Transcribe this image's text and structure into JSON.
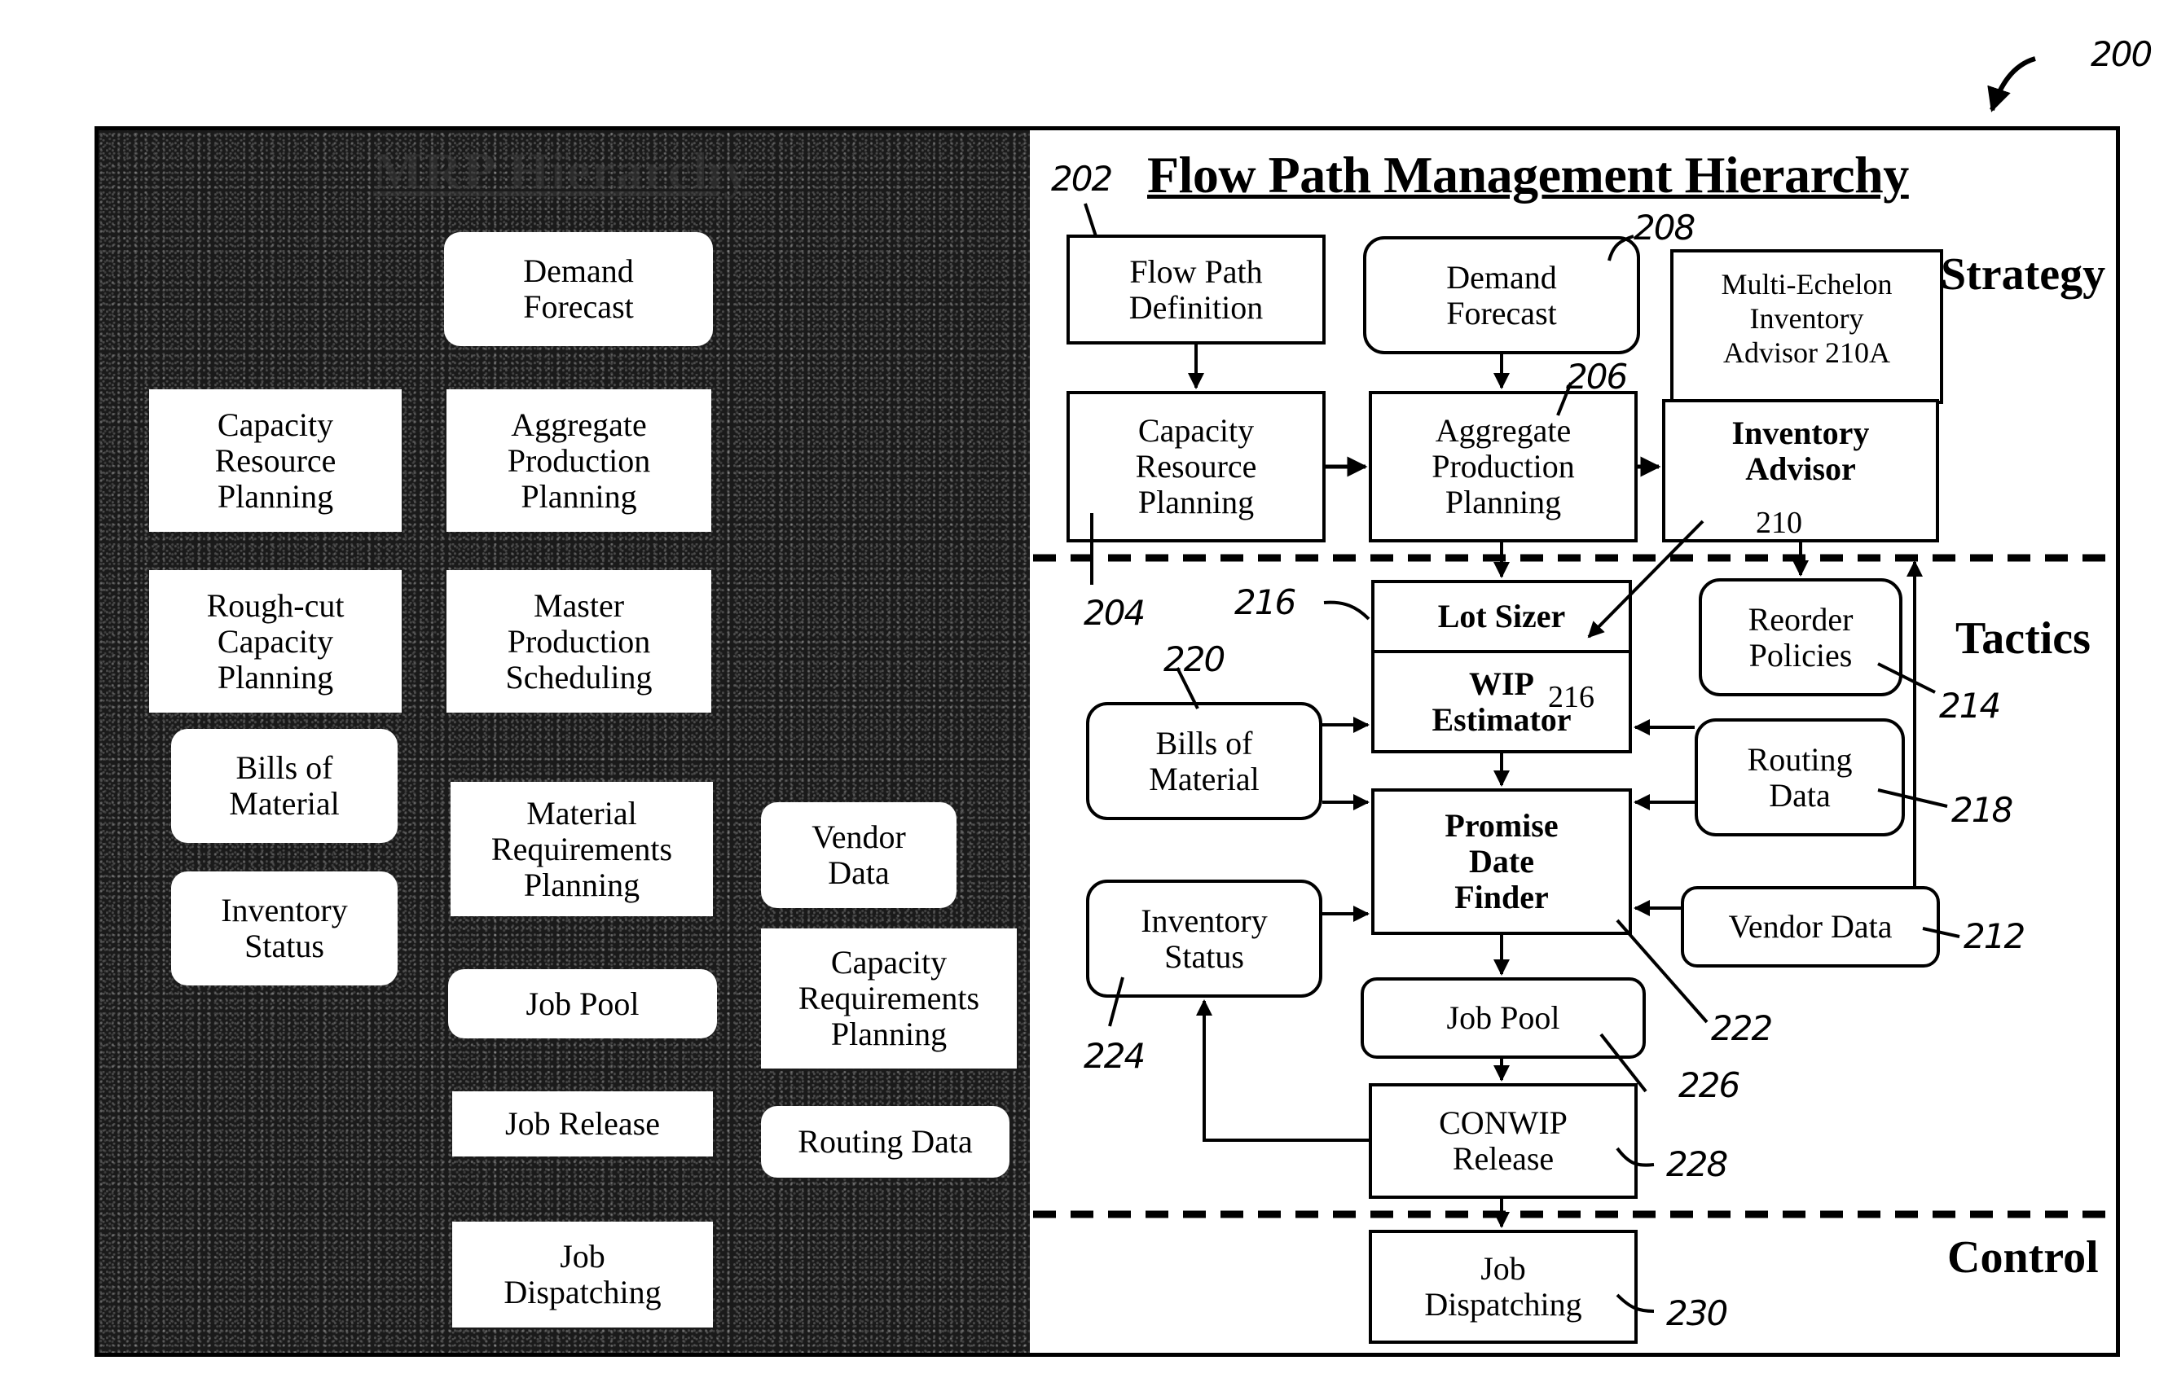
{
  "figure": {
    "reference_number": "200",
    "left_panel": {
      "title": "MRP Hierarchy",
      "boxes": {
        "demand_forecast": "Demand\nForecast",
        "capacity_resource_planning": "Capacity\nResource\nPlanning",
        "aggregate_production_planning": "Aggregate\nProduction\nPlanning",
        "rough_cut_capacity_planning": "Rough-cut\nCapacity\nPlanning",
        "master_production_scheduling": "Master\nProduction\nScheduling",
        "bills_of_material": "Bills of\nMaterial",
        "inventory_status": "Inventory\nStatus",
        "material_requirements_planning": "Material\nRequirements\nPlanning",
        "vendor_data": "Vendor\nData",
        "job_pool": "Job Pool",
        "capacity_requirements_planning": "Capacity\nRequirements\nPlanning",
        "job_release": "Job Release",
        "routing_data": "Routing Data",
        "job_dispatching": "Job\nDispatching"
      }
    },
    "right_panel": {
      "title": "Flow Path Management Hierarchy",
      "tiers": {
        "strategy": "Strategy",
        "tactics": "Tactics",
        "control": "Control"
      },
      "boxes": {
        "flow_path_definition": "Flow Path\nDefinition",
        "demand_forecast": "Demand\nForecast",
        "multi_echelon_inventory_advisor": "Multi-Echelon\nInventory\nAdvisor 210A",
        "capacity_resource_planning": "Capacity\nResource\nPlanning",
        "aggregate_production_planning": "Aggregate\nProduction\nPlanning",
        "inventory_advisor": "Inventory\nAdvisor",
        "inventory_advisor_ref": "210",
        "lot_sizer": "Lot Sizer",
        "wip_estimator": "WIP\nEstimator",
        "wip_estimator_ref": "216",
        "reorder_policies": "Reorder\nPolicies",
        "bills_of_material": "Bills of\nMaterial",
        "routing_data": "Routing\nData",
        "promise_date_finder": "Promise\nDate\nFinder",
        "inventory_status": "Inventory\nStatus",
        "vendor_data": "Vendor Data",
        "job_pool": "Job Pool",
        "conwip_release": "CONWIP\nRelease",
        "job_dispatching": "Job\nDispatching"
      },
      "reference_labels": {
        "r202": "202",
        "r204": "204",
        "r206": "206",
        "r208": "208",
        "r212": "212",
        "r214": "214",
        "r216": "216",
        "r218": "218",
        "r220": "220",
        "r222": "222",
        "r224": "224",
        "r226": "226",
        "r228": "228",
        "r230": "230"
      }
    }
  }
}
